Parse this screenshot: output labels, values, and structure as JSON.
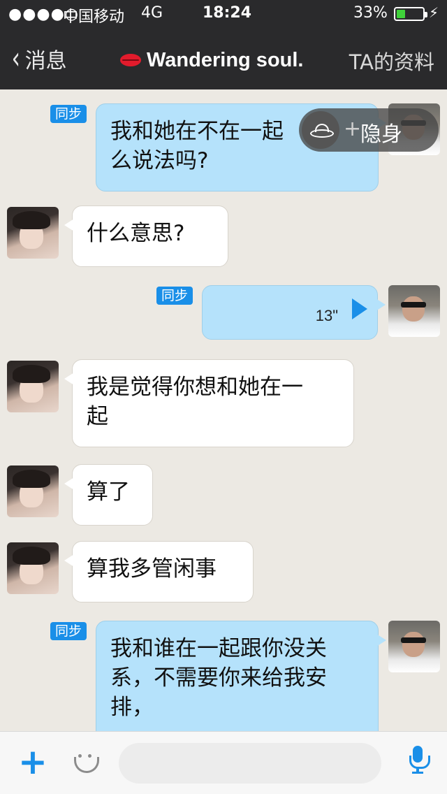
{
  "status_bar": {
    "signal": "●●●●○",
    "carrier": "中国移动",
    "network": "4G",
    "time": "18:24",
    "battery_pct": "33%",
    "battery_level": 0.33,
    "charging_icon": "lightning-icon"
  },
  "nav": {
    "back_label": "消息",
    "title": "Wandering soul.",
    "title_icon": "lips-icon",
    "profile_label": "TA的资料"
  },
  "sync_label": "同步",
  "messages": [
    {
      "side": "out",
      "text": "我和她在不在一起有什么说法吗?",
      "text_visible": "我和她在不在一起\n么说法吗?",
      "synced": true
    },
    {
      "side": "in",
      "text": "什么意思?"
    },
    {
      "side": "out",
      "type": "voice",
      "duration": "13\"",
      "synced": true
    },
    {
      "side": "in",
      "text": "我是觉得你想和她在一起"
    },
    {
      "side": "in",
      "text": "算了"
    },
    {
      "side": "in",
      "text": "算我多管闲事"
    },
    {
      "side": "out",
      "text": "我和谁在一起跟你没关系，不需要你来给我安排，",
      "synced": true
    }
  ],
  "msg1_line1": "我和她在不在一起",
  "msg1_line2": "么说法吗?",
  "msg4_line1": "我是觉得你想和她在一",
  "msg4_line2": "起",
  "msg7_line1": "我和谁在一起跟你没关",
  "msg7_line2": "系，不需要你来给我安",
  "msg7_line3": "排，",
  "stealth": {
    "plus": "+",
    "label": "隐身",
    "icon": "ufo-icon"
  },
  "input_bar": {
    "add_label": "+",
    "emoji_icon": "smile-icon",
    "placeholder": "",
    "mic_icon": "microphone-icon"
  },
  "colors": {
    "header_bg": "#2a2a2c",
    "outgoing_bubble": "#b5e2fb",
    "incoming_bubble": "#ffffff",
    "accent": "#1a8fe8",
    "chat_bg": "#ece9e3"
  }
}
